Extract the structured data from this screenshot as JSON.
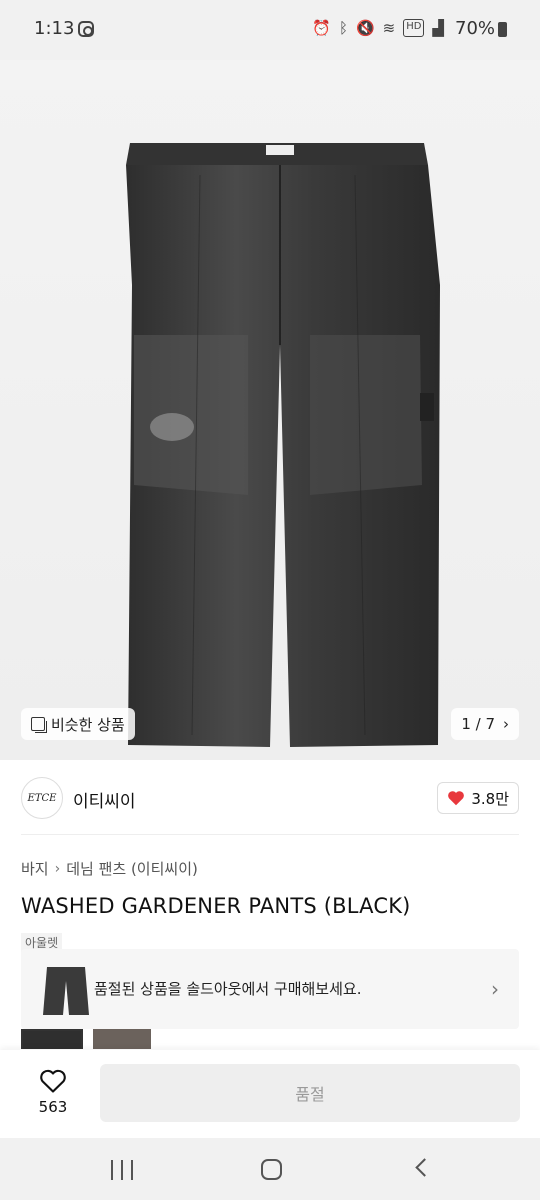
{
  "status_bar": {
    "time": "1:13",
    "battery": "70%",
    "icons": [
      "instagram-icon",
      "alarm-icon",
      "bluetooth-icon",
      "mute-icon",
      "wifi-icon",
      "hd-icon",
      "signal-icon",
      "battery-icon"
    ]
  },
  "hero": {
    "similar_label": "비슷한 상품",
    "pager": "1 / 7"
  },
  "seller": {
    "logo_text": "ETCE",
    "name": "이티씨이",
    "likes": "3.8만"
  },
  "breadcrumb": [
    "바지",
    "데님 팬츠 (이티씨이)"
  ],
  "product": {
    "title": "WASHED GARDENER PANTS (BLACK)"
  },
  "outlet": {
    "label": "아울렛",
    "message": "품절된 상품을 솔드아웃에서 구매해보세요."
  },
  "action_bar": {
    "wish_count": "563",
    "button_label": "품절"
  },
  "colors": {
    "accent_red": "#e8383d",
    "disabled_bg": "#eeeeee",
    "disabled_text": "#9a9a9a"
  }
}
